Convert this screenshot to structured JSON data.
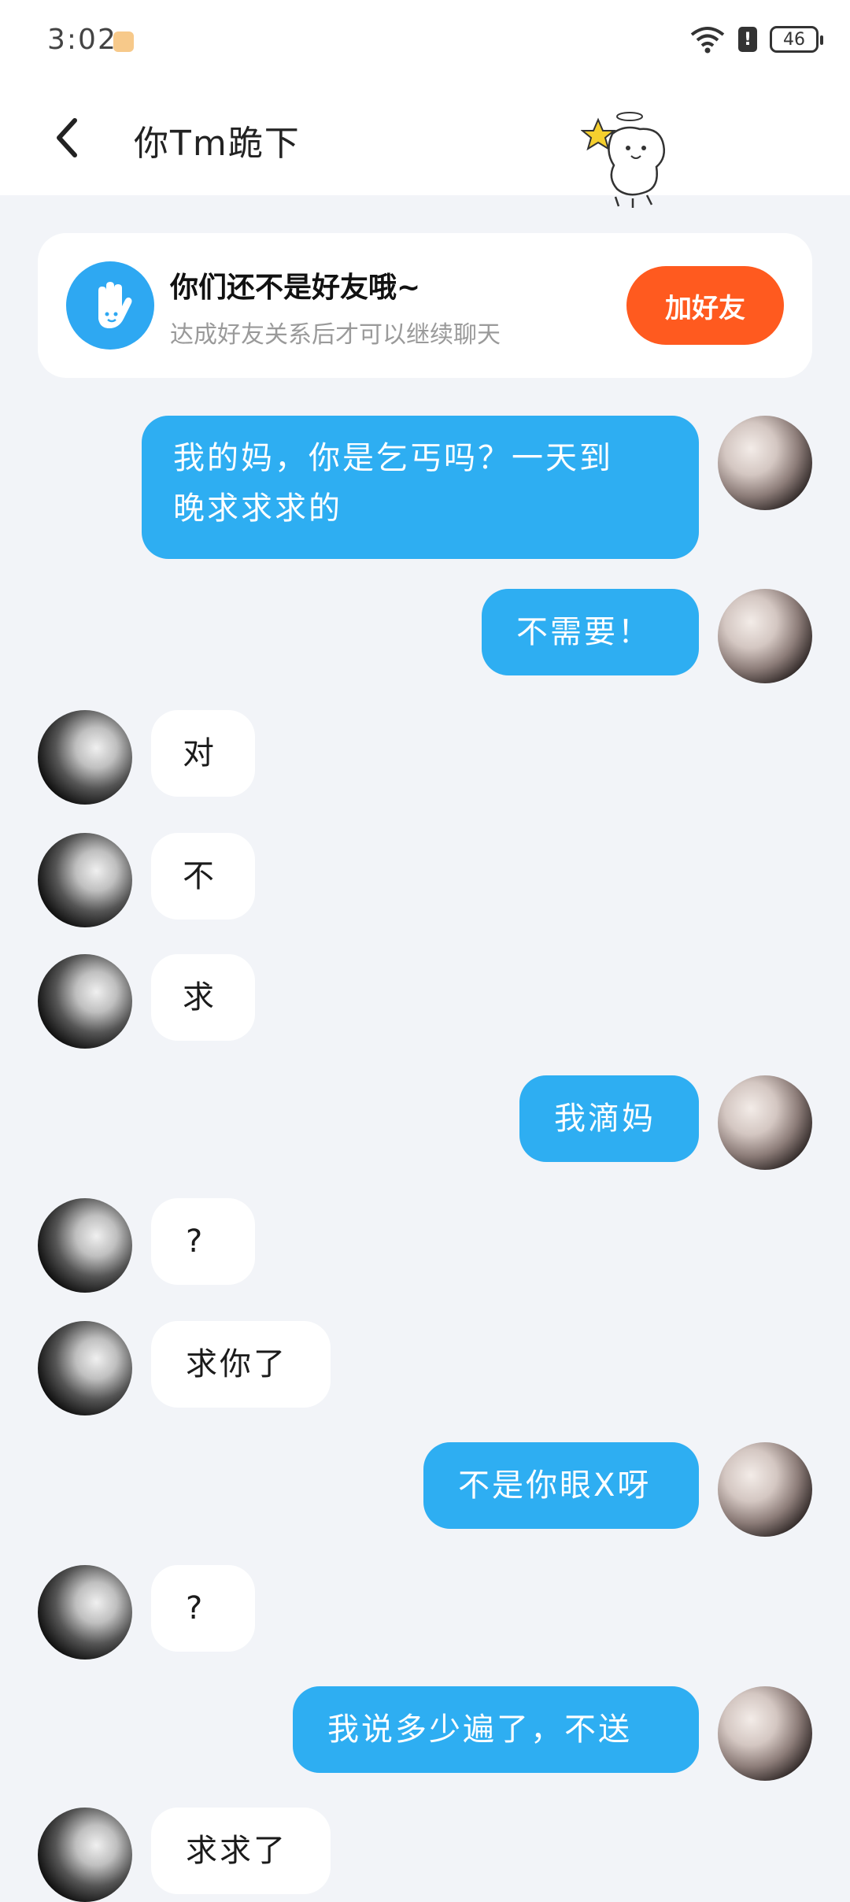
{
  "status_bar": {
    "time": "3:02",
    "battery": "46",
    "alert": "!"
  },
  "header": {
    "title": "你Tm跪下"
  },
  "friend_card": {
    "title": "你们还不是好友哦~",
    "subtitle": "达成好友关系后才可以继续聊天",
    "button": "加好友"
  },
  "messages": [
    {
      "side": "right",
      "text": "我的妈，你是乞丐吗？一天到\n晚求求求的"
    },
    {
      "side": "right",
      "text": "不需要！"
    },
    {
      "side": "left",
      "text": "对"
    },
    {
      "side": "left",
      "text": "不"
    },
    {
      "side": "left",
      "text": "求"
    },
    {
      "side": "right",
      "text": "我滴妈"
    },
    {
      "side": "left",
      "text": "?"
    },
    {
      "side": "left",
      "text": "求你了"
    },
    {
      "side": "right",
      "text": "不是你眼X呀"
    },
    {
      "side": "left",
      "text": "?"
    },
    {
      "side": "right",
      "text": "我说多少遍了，不送"
    },
    {
      "side": "left",
      "text": "求求了"
    }
  ]
}
